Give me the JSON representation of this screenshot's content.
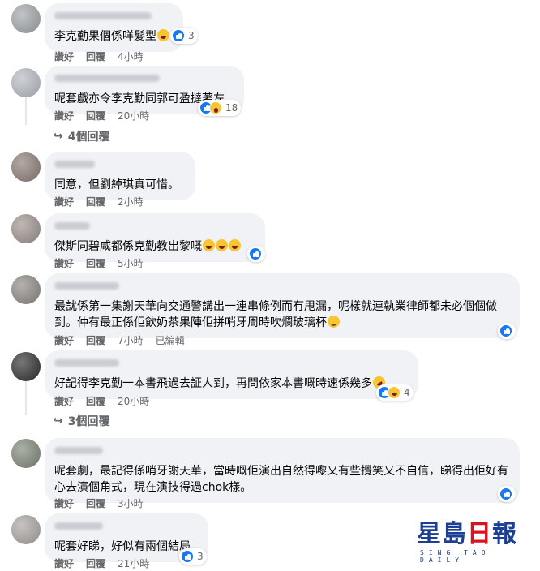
{
  "actions": {
    "like": "讚好",
    "reply": "回覆"
  },
  "comments": [
    {
      "text": "李克勤果個係咩髮型",
      "time": "4小時",
      "reaction_count": "3"
    },
    {
      "text": "呢套戲亦令李克勤同郭可盈撻著左",
      "time": "20小時",
      "reaction_count": "18",
      "replies": "4個回覆"
    },
    {
      "text": "同意，但劉綽琪真可惜。",
      "time": "2小時"
    },
    {
      "text": "傑斯同碧咸都係克勤教出黎嘅",
      "time": "5小時"
    },
    {
      "text": "最訧係第一集謝天華向交通警講出一連串條例而冇甩漏，呢樣就連執業律師都未必個個做到。仲有最正係佢飲奶茶果陣佢拼哨牙周時吹爛玻璃杯",
      "time": "7小時",
      "edited": "已編輯"
    },
    {
      "text": "好記得李克勤一本書飛過去証人到，再問依家本書嘅時速係幾多",
      "time": "20小時",
      "reaction_count": "4",
      "replies": "3個回覆"
    },
    {
      "text": "呢套劇，最記得係哨牙謝天華，當時嘅佢演出自然得嚟又有些攪笑又不自信，睇得出佢好有心去演個角式，現在演技得過chok樣。",
      "time": "3小時"
    },
    {
      "text": "呢套好睇，好似有兩個結局",
      "time": "21小時",
      "reaction_count": "3"
    }
  ],
  "logo": {
    "text": "星島日報",
    "subtitle": "SING TAO DAILY"
  },
  "icons": {
    "like": "like-reaction-icon",
    "haha": "haha-reaction-icon",
    "wow": "wow-reaction-icon",
    "reply_arrow": "reply-arrow-icon"
  },
  "colors": {
    "bubble": "#f0f2f5",
    "meta": "#65676b",
    "like_blue": "#1877f2",
    "logo_blue": "#1c3f94",
    "logo_red": "#d7141f"
  }
}
